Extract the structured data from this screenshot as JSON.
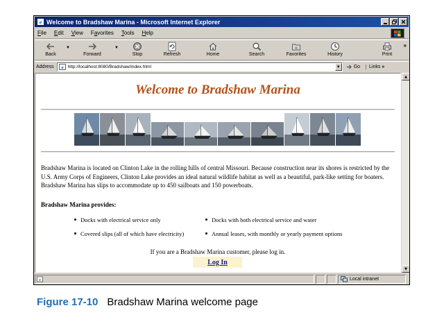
{
  "window": {
    "title": "Welcome to Bradshaw Marina - Microsoft Internet Explorer"
  },
  "menu": [
    "File",
    "Edit",
    "View",
    "Favorites",
    "Tools",
    "Help"
  ],
  "toolbar": {
    "buttons": [
      {
        "label": "Back",
        "icon": "back-arrow-icon"
      },
      {
        "label": "Forward",
        "icon": "forward-arrow-icon"
      },
      {
        "label": "Stop",
        "icon": "stop-icon"
      },
      {
        "label": "Refresh",
        "icon": "refresh-icon"
      },
      {
        "label": "Home",
        "icon": "home-icon"
      },
      {
        "label": "Search",
        "icon": "search-icon"
      },
      {
        "label": "Favorites",
        "icon": "favorites-icon"
      },
      {
        "label": "History",
        "icon": "history-icon"
      },
      {
        "label": "Print",
        "icon": "print-icon"
      }
    ]
  },
  "address": {
    "label": "Address",
    "url": "http://localhost:8080/Bradshaw/index.html",
    "go_label": "Go",
    "links_label": "Links"
  },
  "page": {
    "title": "Welcome to Bradshaw Marina",
    "intro": "Bradshaw Marina is located on Clinton Lake in the rolling hills of central Missouri. Because construction near its shores is restricted by the U.S. Army Corps of Engineers, Clinton Lake provides an ideal natural wildlife habitat as well as a beautiful, park-like setting for boaters. Bradshaw Marina has slips to accommodate up to 450 sailboats and 150 powerboats.",
    "provides_heading": "Bradshaw Marina provides:",
    "features_left": [
      "Docks with electrical service only",
      "Covered slips (all of which have electricity)"
    ],
    "features_right": [
      "Docks with both electrical service and water",
      "Annual leases, with monthly or yearly payment options"
    ],
    "customer_msg": "If you are a Bradshaw Marina customer, please log in.",
    "login_label": "Log In"
  },
  "photos": [
    {
      "kind": "tall",
      "sky": "#6f8aa6",
      "water": "#3d4d5e",
      "sail": "#e8e8e8"
    },
    {
      "kind": "tall",
      "sky": "#8a8f98",
      "water": "#4a5058",
      "sail": "#f0f0f0"
    },
    {
      "kind": "tall",
      "sky": "#a8b2bc",
      "water": "#5a6470",
      "sail": "#ffffff"
    },
    {
      "kind": "wide",
      "sky": "#8d97a3",
      "water": "#4a5561",
      "sail": "#dcdcdc"
    },
    {
      "kind": "wide",
      "sky": "#b0b8c2",
      "water": "#6a747e",
      "sail": "#f4f4f4"
    },
    {
      "kind": "wide",
      "sky": "#9aa3ad",
      "water": "#555f6a",
      "sail": "#e6e6e6"
    },
    {
      "kind": "wide",
      "sky": "#7a848f",
      "water": "#3e4852",
      "sail": "#d0d0d0"
    },
    {
      "kind": "tall",
      "sky": "#c4ccd4",
      "water": "#707a84",
      "sail": "#ffffff"
    },
    {
      "kind": "tall",
      "sky": "#7d8894",
      "water": "#46505a",
      "sail": "#e0e0e0"
    },
    {
      "kind": "tall",
      "sky": "#8fa0b3",
      "water": "#3f4b58",
      "sail": "#efefef"
    }
  ],
  "status": {
    "zone": "Local intranet"
  },
  "caption": {
    "figure": "Figure 17-10",
    "text": "Bradshaw Marina welcome page"
  },
  "colors": {
    "title_bar": "#0a246a",
    "heading": "#b5521a",
    "login_bg": "#fbf2cf",
    "caption_number": "#1d6fb5"
  }
}
